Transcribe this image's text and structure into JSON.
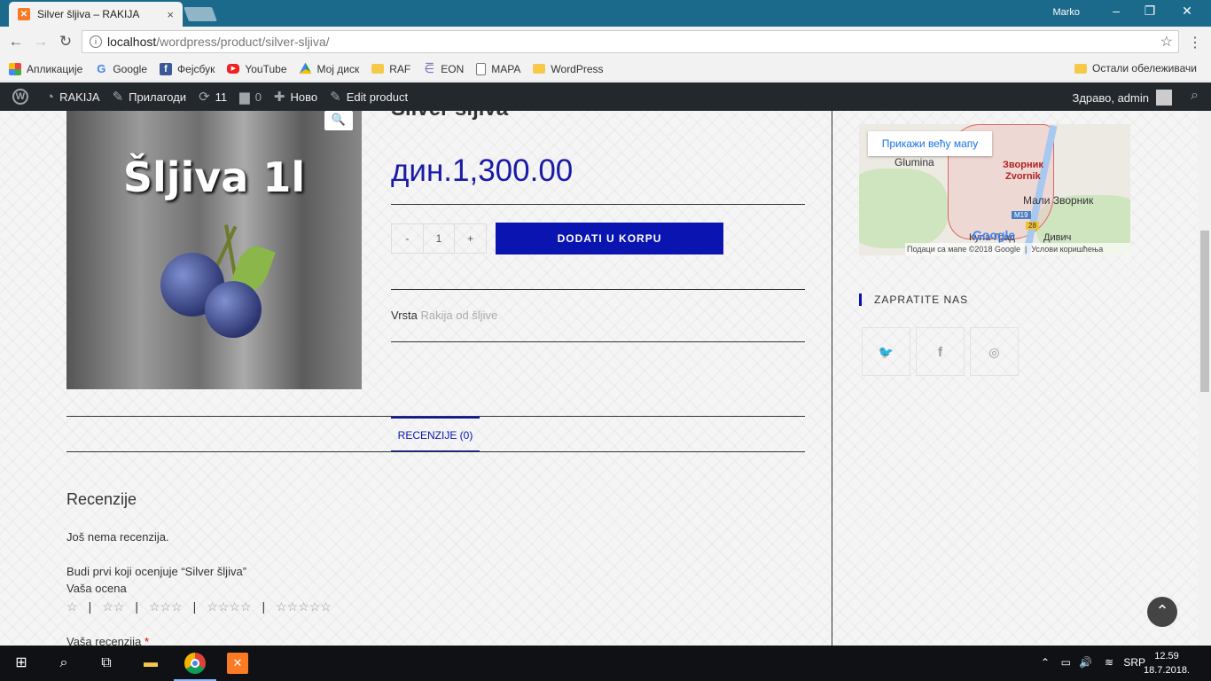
{
  "browser": {
    "tab_title": "Silver šljiva – RAKIJA",
    "tab_close": "×",
    "user": "Marko",
    "url_host": "localhost",
    "url_path": "/wordpress/product/silver-sljiva/",
    "controls": {
      "minimize": "–",
      "restore": "❐",
      "close": "✕"
    },
    "nav": {
      "back": "←",
      "forward": "→",
      "reload": "↻"
    }
  },
  "bookmarks": {
    "items": [
      {
        "label": "Апликације",
        "icon": "apps-icon"
      },
      {
        "label": "Google",
        "icon": "google-icon"
      },
      {
        "label": "Фејсбук",
        "icon": "facebook-icon"
      },
      {
        "label": "YouTube",
        "icon": "youtube-icon"
      },
      {
        "label": "Мој диск",
        "icon": "drive-icon"
      },
      {
        "label": "RAF",
        "icon": "folder-icon"
      },
      {
        "label": "EON",
        "icon": "eon-icon"
      },
      {
        "label": "MAPA",
        "icon": "page-icon"
      },
      {
        "label": "WordPress",
        "icon": "folder-icon"
      }
    ],
    "other": "Остали обележивачи"
  },
  "adminbar": {
    "site": "RAKIJA",
    "customize": "Прилагоди",
    "updates": "11",
    "comments": "0",
    "new": "Ново",
    "edit": "Edit product",
    "greeting": "Здраво, admin"
  },
  "product": {
    "image_text": "Šljiva 1l",
    "title": "Silver šljiva",
    "price": "дин.1,300.00",
    "qty_minus": "-",
    "qty_value": "1",
    "qty_plus": "+",
    "add_to_cart": "DODATI U KORPU",
    "meta_label": "Vrsta",
    "meta_value": "Rakija od šljive"
  },
  "tabs": {
    "reviews": "RECENZIJE (0)"
  },
  "reviews": {
    "heading": "Recenzije",
    "none": "Još nema recenzija.",
    "first": "Budi prvi koji ocenjuje “Silver šljiva”",
    "your_rating": "Vaša ocena",
    "your_review": "Vaša recenzija",
    "required": "*",
    "stars": [
      "☆",
      "☆☆",
      "☆☆☆",
      "☆☆☆☆",
      "☆☆☆☆☆"
    ],
    "star_separator": "|"
  },
  "map": {
    "button": "Прикажи већу мапу",
    "labels": {
      "glumina": "Glumina",
      "zvornik_cyr": "Зворник",
      "zvornik_lat": "Zvornik",
      "mali_zvornik": "Мали Зворник",
      "kula_grad": "Кула-Град",
      "divic": "Дивич",
      "m19": "M19",
      "r28": "28",
      "google": "Google"
    },
    "footer_data": "Подаци са мапе ©2018 Google",
    "footer_terms": "Услови коришћења"
  },
  "sidebar": {
    "follow_title": "ZAPRATITE NAS",
    "social": [
      "twitter-icon",
      "facebook-icon",
      "instagram-icon"
    ]
  },
  "taskbar": {
    "lang": "SRP",
    "time": "12.59",
    "date": "18.7.2018."
  }
}
